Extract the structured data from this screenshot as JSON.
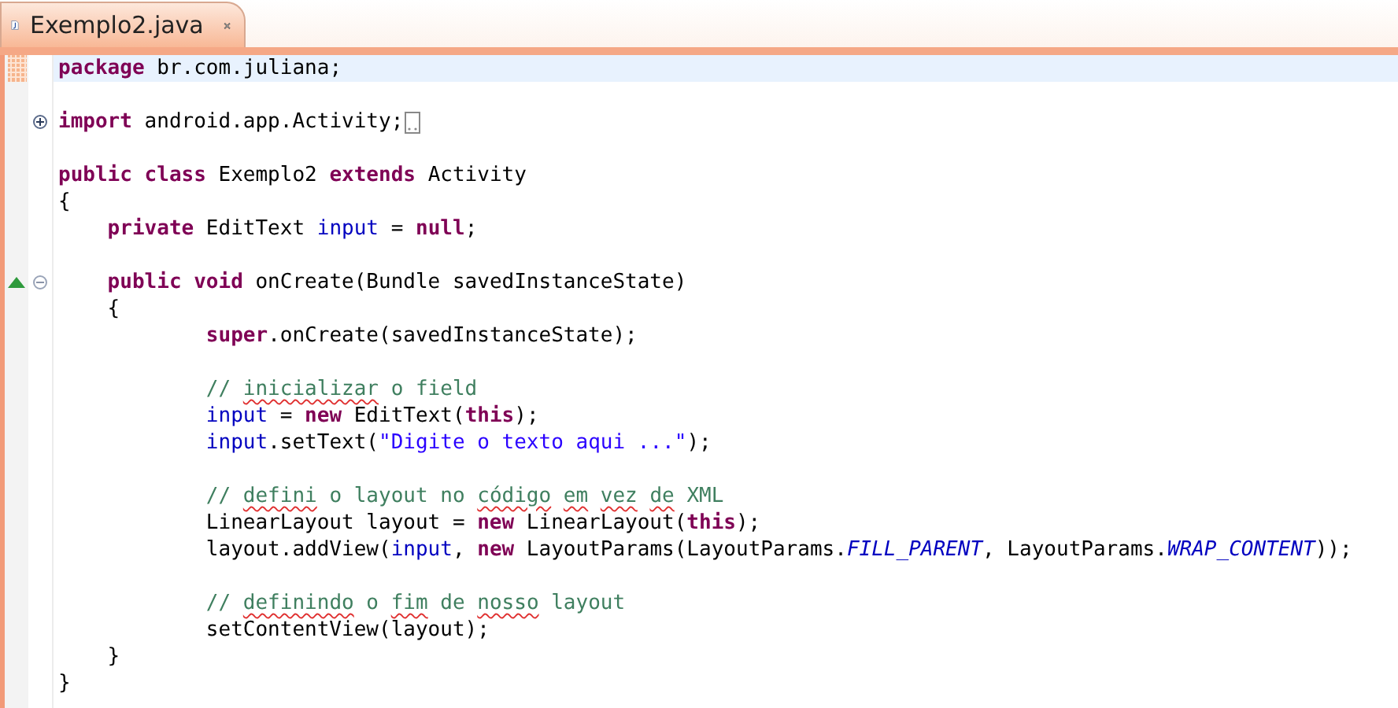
{
  "tab": {
    "title": "Exemplo2.java",
    "selected": true
  },
  "lines": [
    {
      "kind": "code",
      "current": true,
      "segments": [
        {
          "kind": "keyword",
          "text": "package"
        },
        {
          "kind": "plain",
          "text": " br.com.juliana;"
        }
      ]
    },
    {
      "kind": "blank",
      "current": false
    },
    {
      "kind": "code",
      "current": false,
      "foldable": true,
      "expanded": false,
      "folded_tail": true,
      "segments": [
        {
          "kind": "keyword",
          "text": "import"
        },
        {
          "kind": "plain",
          "text": " android.app.Activity;"
        }
      ]
    },
    {
      "kind": "blank",
      "current": false
    },
    {
      "kind": "code",
      "current": false,
      "segments": [
        {
          "kind": "keyword",
          "text": "public class"
        },
        {
          "kind": "plain",
          "text": " Exemplo2 "
        },
        {
          "kind": "keyword",
          "text": "extends"
        },
        {
          "kind": "plain",
          "text": " Activity"
        }
      ]
    },
    {
      "kind": "code",
      "current": false,
      "segments": [
        {
          "kind": "plain",
          "text": "{"
        }
      ]
    },
    {
      "kind": "code",
      "current": false,
      "segments": [
        {
          "kind": "keyword",
          "text": "    private"
        },
        {
          "kind": "plain",
          "text": " EditText "
        },
        {
          "kind": "field",
          "text": "input"
        },
        {
          "kind": "plain",
          "text": " = "
        },
        {
          "kind": "keyword",
          "text": "null"
        },
        {
          "kind": "plain",
          "text": ";"
        }
      ]
    },
    {
      "kind": "blank",
      "current": false
    },
    {
      "kind": "code",
      "current": false,
      "foldable": true,
      "expanded": true,
      "override": true,
      "segments": [
        {
          "kind": "keyword",
          "text": "    public void"
        },
        {
          "kind": "plain",
          "text": " onCreate(Bundle savedInstanceState)"
        }
      ]
    },
    {
      "kind": "code",
      "current": false,
      "segments": [
        {
          "kind": "plain",
          "text": "    {"
        }
      ]
    },
    {
      "kind": "code",
      "current": false,
      "segments": [
        {
          "kind": "keyword",
          "text": "            super"
        },
        {
          "kind": "plain",
          "text": ".onCreate(savedInstanceState);"
        }
      ]
    },
    {
      "kind": "blank",
      "current": false
    },
    {
      "kind": "code",
      "current": false,
      "segments": [
        {
          "kind": "comment",
          "text": "            // "
        },
        {
          "kind": "misspelled",
          "text": "inicializar"
        },
        {
          "kind": "comment",
          "text": " o field"
        }
      ]
    },
    {
      "kind": "code",
      "current": false,
      "segments": [
        {
          "kind": "field",
          "text": "            input"
        },
        {
          "kind": "plain",
          "text": " = "
        },
        {
          "kind": "keyword",
          "text": "new"
        },
        {
          "kind": "plain",
          "text": " EditText("
        },
        {
          "kind": "keyword",
          "text": "this"
        },
        {
          "kind": "plain",
          "text": ");"
        }
      ]
    },
    {
      "kind": "code",
      "current": false,
      "segments": [
        {
          "kind": "field",
          "text": "            input"
        },
        {
          "kind": "plain",
          "text": ".setText("
        },
        {
          "kind": "string",
          "text": "\"Digite o texto aqui ...\""
        },
        {
          "kind": "plain",
          "text": ");"
        }
      ]
    },
    {
      "kind": "blank",
      "current": false
    },
    {
      "kind": "code",
      "current": false,
      "segments": [
        {
          "kind": "comment",
          "text": "            // "
        },
        {
          "kind": "misspelled",
          "text": "defini"
        },
        {
          "kind": "comment",
          "text": " o layout no "
        },
        {
          "kind": "misspelled",
          "text": "código"
        },
        {
          "kind": "misspelled",
          "text": " em"
        },
        {
          "kind": "misspelled",
          "text": " vez"
        },
        {
          "kind": "misspelled",
          "text": " de"
        },
        {
          "kind": "comment",
          "text": " XML"
        }
      ]
    },
    {
      "kind": "code",
      "current": false,
      "segments": [
        {
          "kind": "plain",
          "text": "            LinearLayout layout = "
        },
        {
          "kind": "keyword",
          "text": "new"
        },
        {
          "kind": "plain",
          "text": " LinearLayout("
        },
        {
          "kind": "keyword",
          "text": "this"
        },
        {
          "kind": "plain",
          "text": ");"
        }
      ]
    },
    {
      "kind": "code",
      "current": false,
      "segments": [
        {
          "kind": "plain",
          "text": "            layout.addView("
        },
        {
          "kind": "field",
          "text": "input"
        },
        {
          "kind": "plain",
          "text": ", "
        },
        {
          "kind": "keyword",
          "text": "new"
        },
        {
          "kind": "plain",
          "text": " LayoutParams(LayoutParams."
        },
        {
          "kind": "constant",
          "text": "FILL_PARENT"
        },
        {
          "kind": "plain",
          "text": ", LayoutParams."
        },
        {
          "kind": "constant",
          "text": "WRAP_CONTENT"
        },
        {
          "kind": "plain",
          "text": "));"
        }
      ]
    },
    {
      "kind": "blank",
      "current": false
    },
    {
      "kind": "code",
      "current": false,
      "segments": [
        {
          "kind": "comment",
          "text": "            // "
        },
        {
          "kind": "misspelled",
          "text": "definindo"
        },
        {
          "kind": "comment",
          "text": " o "
        },
        {
          "kind": "misspelled",
          "text": "fim"
        },
        {
          "kind": "comment",
          "text": " de "
        },
        {
          "kind": "misspelled",
          "text": "nosso"
        },
        {
          "kind": "comment",
          "text": " layout"
        }
      ]
    },
    {
      "kind": "code",
      "current": false,
      "segments": [
        {
          "kind": "plain",
          "text": "            setContentView(layout);"
        }
      ]
    },
    {
      "kind": "code",
      "current": false,
      "segments": [
        {
          "kind": "plain",
          "text": "    }"
        }
      ]
    },
    {
      "kind": "code",
      "current": false,
      "segments": [
        {
          "kind": "plain",
          "text": "}"
        }
      ]
    }
  ]
}
